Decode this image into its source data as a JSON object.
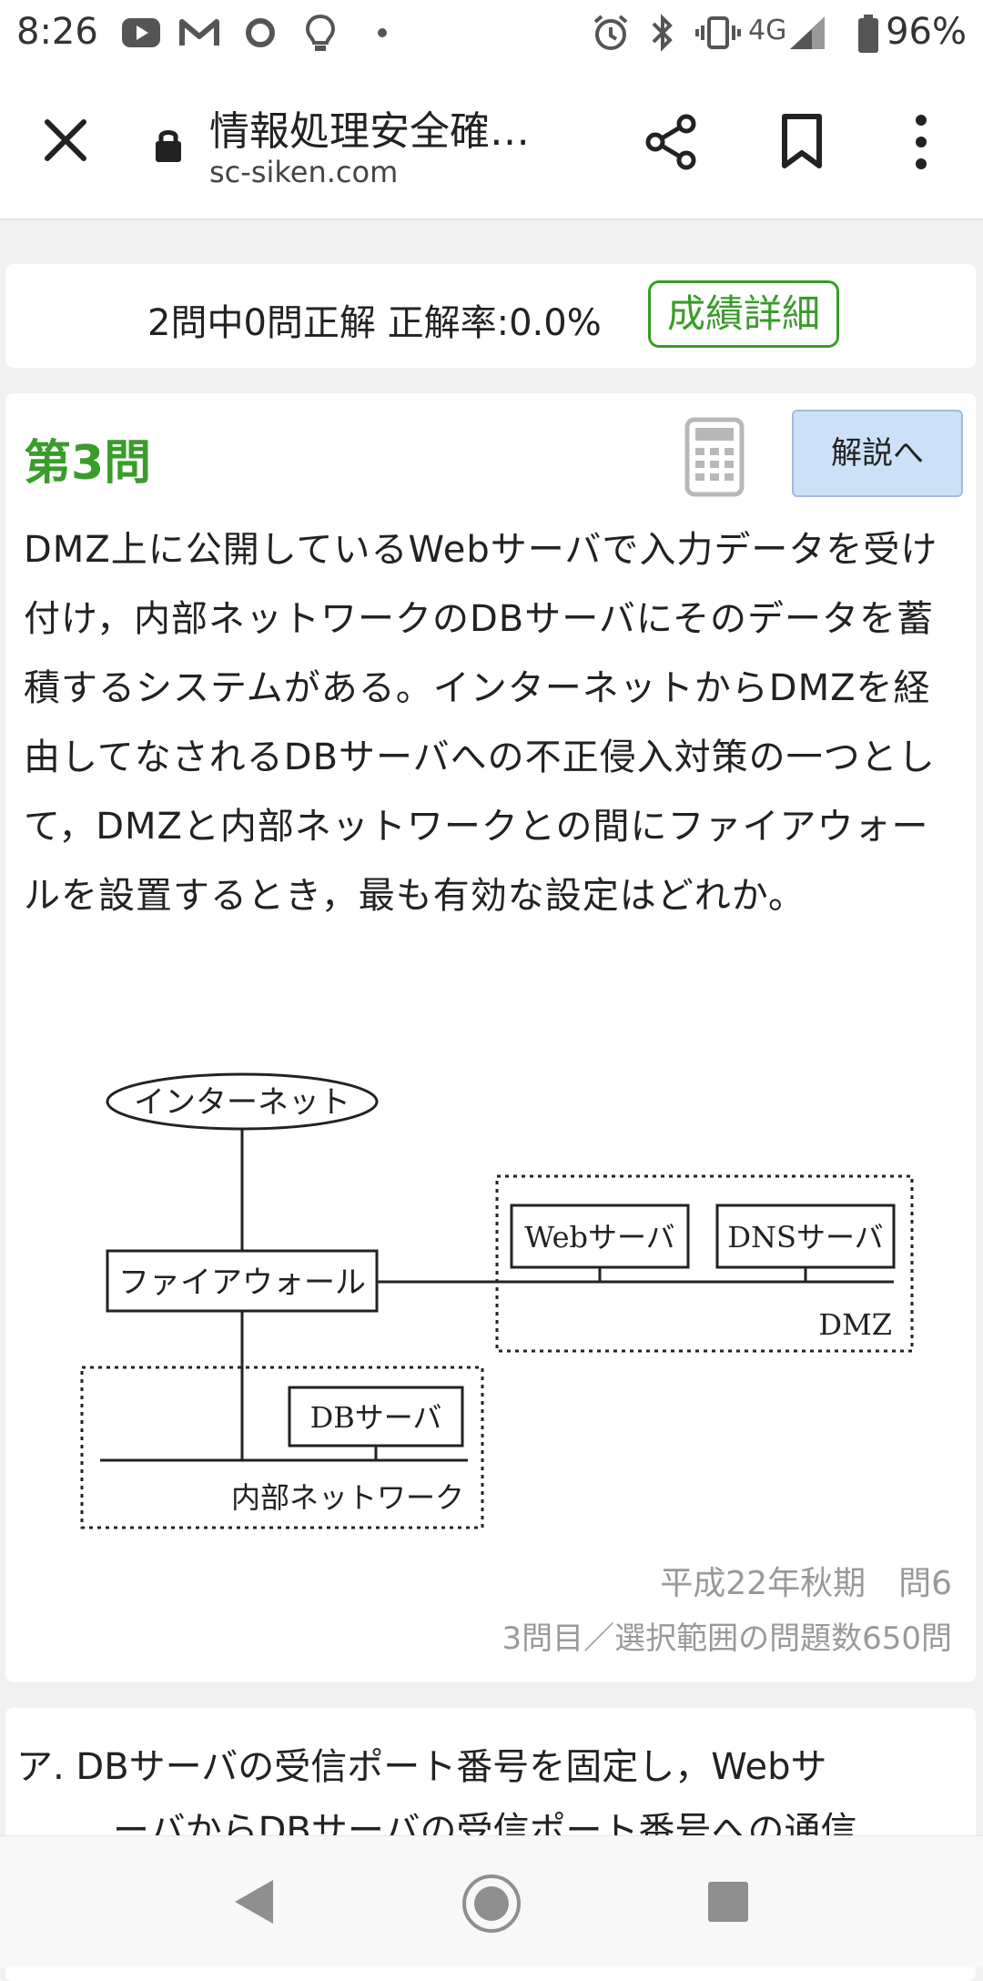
{
  "status_bar": {
    "time": "8:26",
    "network": "4G",
    "battery": "96%",
    "icons": [
      "youtube-icon",
      "gmail-icon",
      "circle-icon",
      "lightbulb-icon",
      "dot-icon",
      "alarm-icon",
      "bluetooth-icon",
      "vibrate-icon",
      "signal-icon",
      "battery-icon"
    ]
  },
  "toolbar": {
    "title": "情報処理安全確…",
    "url": "sc-siken.com"
  },
  "score": {
    "text": "2問中0問正解 正解率:0.0%",
    "detail_button": "成績詳細"
  },
  "question": {
    "number": "第3問",
    "explain_button": "解説へ",
    "body": "DMZ上に公開しているWebサーバで入力データを受け付け，内部ネットワークのDBサーバにそのデータを蓄積するシステムがある。インターネットからDMZを経由してなされるDBサーバへの不正侵入対策の一つとして，DMZと内部ネットワークとの間にファイアウォールを設置するとき，最も有効な設定はどれか。",
    "diagram": {
      "internet": "インターネット",
      "firewall": "ファイアウォール",
      "web_server": "Webサーバ",
      "dns_server": "DNSサーバ",
      "dmz": "DMZ",
      "db_server": "DBサーバ",
      "internal_network": "内部ネットワーク"
    },
    "source": "平成22年秋期　問6",
    "meta": "3問目／選択範囲の問題数650問"
  },
  "answer": {
    "a_line1": "ア. DBサーバの受信ポート番号を固定し，Webサ",
    "a_line2": "ーバからDBサーバの受信ポート番号への通信"
  },
  "colors": {
    "accent_green": "#3a9c2a",
    "explain_bg": "#cce0f7"
  }
}
